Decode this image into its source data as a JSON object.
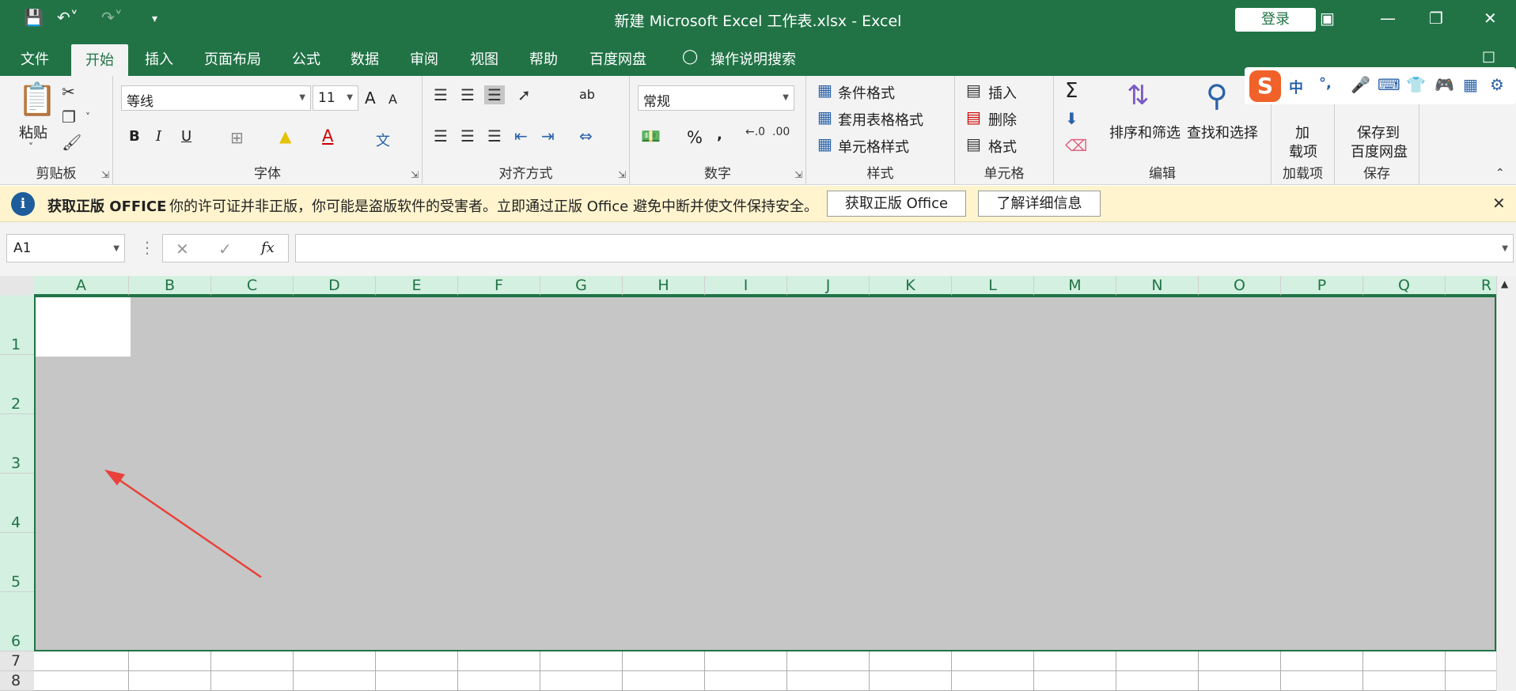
{
  "title": "新建 Microsoft Excel 工作表.xlsx  -  Excel",
  "login": "登录",
  "tabs": [
    "文件",
    "开始",
    "插入",
    "页面布局",
    "公式",
    "数据",
    "审阅",
    "视图",
    "帮助",
    "百度网盘"
  ],
  "tell_me": "操作说明搜索",
  "ribbon": {
    "clipboard": {
      "paste": "粘贴",
      "label": "剪贴板"
    },
    "font": {
      "name": "等线",
      "size": "11",
      "label": "字体",
      "bold": "B",
      "italic": "I",
      "underline": "U",
      "grow": "A",
      "shrink": "A",
      "phonetic": "文",
      "font_color": "A"
    },
    "align": {
      "label": "对齐方式",
      "wrap": "ab"
    },
    "number": {
      "format": "常规",
      "label": "数字",
      "percent": "%",
      "comma": ","
    },
    "styles": {
      "cond": "条件格式",
      "table": "套用表格格式",
      "cell": "单元格样式",
      "label": "样式"
    },
    "cells": {
      "insert": "插入",
      "delete": "删除",
      "format": "格式",
      "label": "单元格"
    },
    "edit": {
      "sort": "排序和筛选",
      "find": "查找和选择",
      "label": "编辑",
      "sum": "Σ"
    },
    "addins": {
      "top": "加",
      "bottom": "载项",
      "label": "加载项"
    },
    "save": {
      "top": "保存到",
      "bottom": "百度网盘",
      "label": "保存"
    }
  },
  "ime": {
    "logo": "S",
    "zh": "中",
    "punct": "°,"
  },
  "message": {
    "title": "获取正版 OFFICE",
    "text": "你的许可证并非正版，你可能是盗版软件的受害者。立即通过正版 Office 避免中断并使文件保持安全。",
    "btn1": "获取正版 Office",
    "btn2": "了解详细信息"
  },
  "namebox": "A1",
  "fx": "fx",
  "columns": [
    "A",
    "B",
    "C",
    "D",
    "E",
    "F",
    "G",
    "H",
    "I",
    "J",
    "K",
    "L",
    "M",
    "N",
    "O",
    "P",
    "Q",
    "R"
  ],
  "rows": [
    "1",
    "2",
    "3",
    "4",
    "5",
    "6",
    "7",
    "8"
  ],
  "colors": {
    "accent": "#217346",
    "selection": "#c6c6c6",
    "arrow": "#e8423a"
  }
}
